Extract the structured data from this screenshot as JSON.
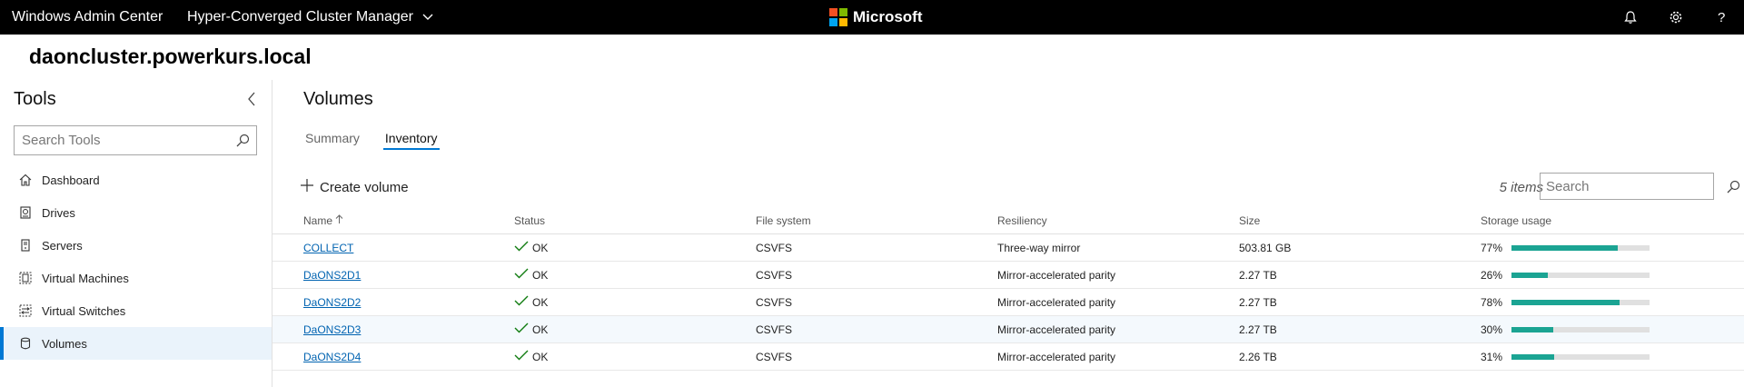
{
  "topbar": {
    "app_title": "Windows Admin Center",
    "manager": "Hyper-Converged Cluster Manager",
    "brand": "Microsoft",
    "brand_colors": [
      "#f25022",
      "#7fba00",
      "#00a4ef",
      "#ffb900"
    ],
    "icons": [
      "notification-bell-icon",
      "gear-icon",
      "help-icon"
    ]
  },
  "cluster_name": "daoncluster.powerkurs.local",
  "sidebar": {
    "title": "Tools",
    "search_placeholder": "Search Tools",
    "items": [
      {
        "label": "Dashboard",
        "icon": "home-icon"
      },
      {
        "label": "Drives",
        "icon": "drive-icon"
      },
      {
        "label": "Servers",
        "icon": "server-icon"
      },
      {
        "label": "Virtual Machines",
        "icon": "virtual-machine-icon"
      },
      {
        "label": "Virtual Switches",
        "icon": "virtual-switch-icon"
      },
      {
        "label": "Volumes",
        "icon": "volume-icon",
        "active": true
      }
    ]
  },
  "main": {
    "title": "Volumes",
    "tabs": [
      {
        "label": "Summary",
        "active": false
      },
      {
        "label": "Inventory",
        "active": true
      }
    ],
    "create_label": "Create volume",
    "items_count": "5 items",
    "search_placeholder": "Search",
    "columns": [
      "Name",
      "Status",
      "File system",
      "Resiliency",
      "Size",
      "Storage usage"
    ],
    "rows": [
      {
        "name": "COLLECT",
        "status": "OK",
        "fs": "CSVFS",
        "resiliency": "Three-way mirror",
        "size": "503.81 GB",
        "usage": "77%",
        "usage_value": 0.77
      },
      {
        "name": "DaONS2D1",
        "status": "OK",
        "fs": "CSVFS",
        "resiliency": "Mirror-accelerated parity",
        "size": "2.27 TB",
        "usage": "26%",
        "usage_value": 0.26
      },
      {
        "name": "DaONS2D2",
        "status": "OK",
        "fs": "CSVFS",
        "resiliency": "Mirror-accelerated parity",
        "size": "2.27 TB",
        "usage": "78%",
        "usage_value": 0.78
      },
      {
        "name": "DaONS2D3",
        "status": "OK",
        "fs": "CSVFS",
        "resiliency": "Mirror-accelerated parity",
        "size": "2.27 TB",
        "usage": "30%",
        "usage_value": 0.3
      },
      {
        "name": "DaONS2D4",
        "status": "OK",
        "fs": "CSVFS",
        "resiliency": "Mirror-accelerated parity",
        "size": "2.26 TB",
        "usage": "31%",
        "usage_value": 0.31
      }
    ],
    "accent_color": "#0078d4",
    "usage_bar_color": "#1ba493",
    "ok_color": "#107c10"
  }
}
